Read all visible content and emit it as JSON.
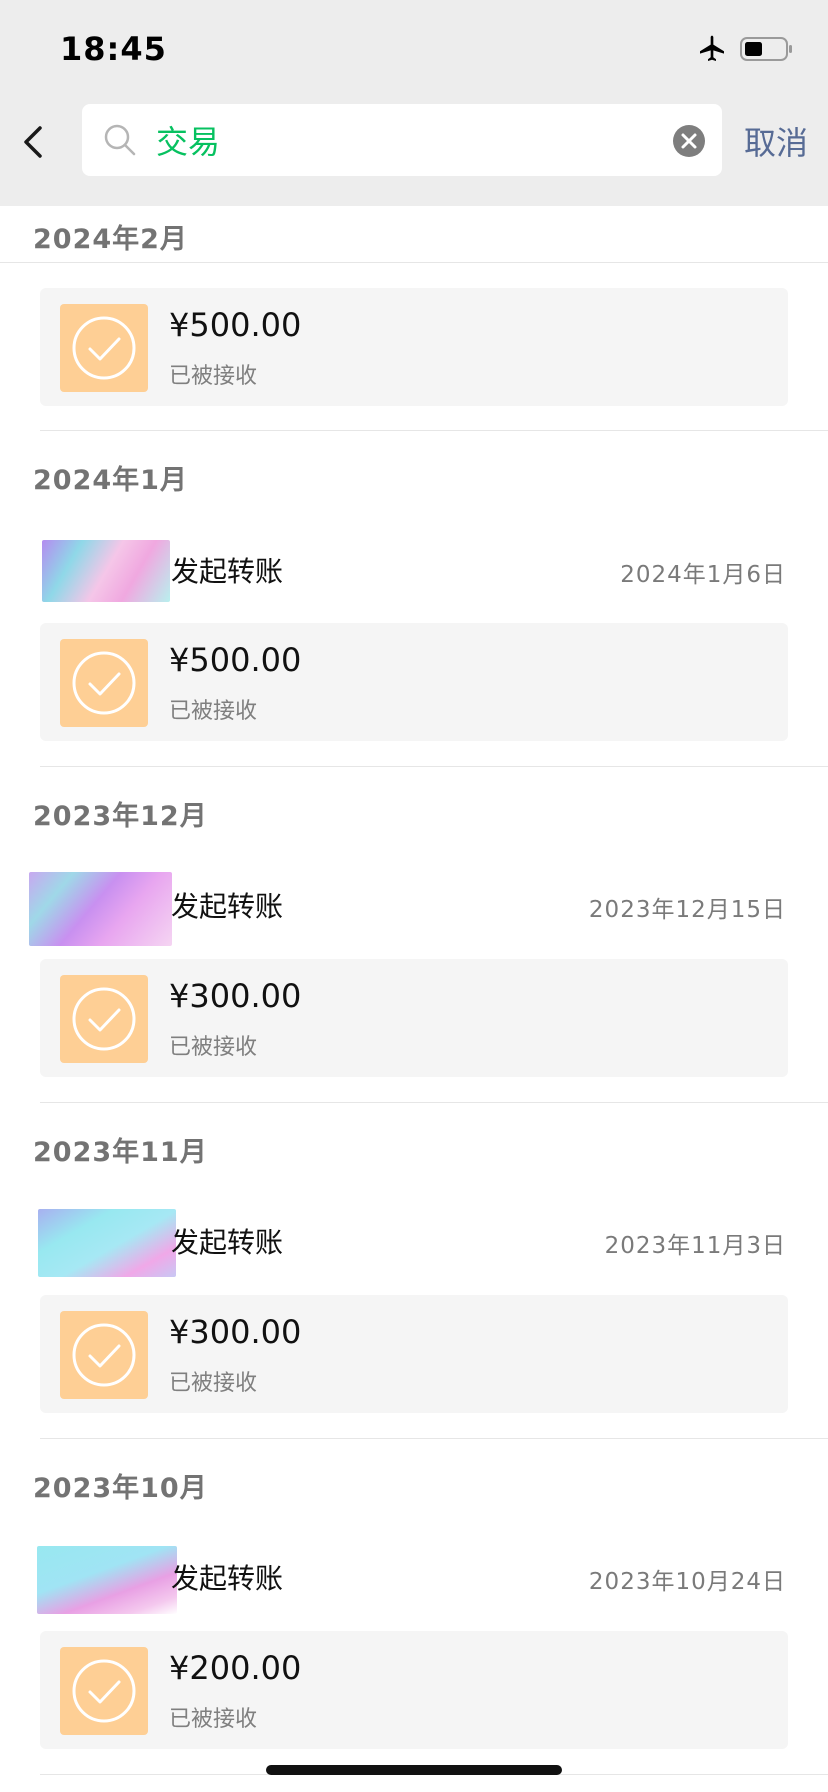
{
  "status_bar": {
    "time": "18:45"
  },
  "search": {
    "query": "交易",
    "cancel_label": "取消"
  },
  "sections": [
    {
      "month": "2024年2月",
      "record": {
        "title": "",
        "date": "",
        "amount": "¥500.00",
        "status": "已被接收"
      }
    },
    {
      "month": "2024年1月",
      "record": {
        "title": "发起转账",
        "date": "2024年1月6日",
        "amount": "¥500.00",
        "status": "已被接收"
      }
    },
    {
      "month": "2023年12月",
      "record": {
        "title": "发起转账",
        "date": "2023年12月15日",
        "amount": "¥300.00",
        "status": "已被接收"
      }
    },
    {
      "month": "2023年11月",
      "record": {
        "title": "发起转账",
        "date": "2023年11月3日",
        "amount": "¥300.00",
        "status": "已被接收"
      }
    },
    {
      "month": "2023年10月",
      "record": {
        "title": "发起转账",
        "date": "2023年10月24日",
        "amount": "¥200.00",
        "status": "已被接收"
      }
    }
  ],
  "colors": {
    "accent_green": "#07c160",
    "link_blue": "#576b95",
    "icon_orange": "#fecf95"
  }
}
